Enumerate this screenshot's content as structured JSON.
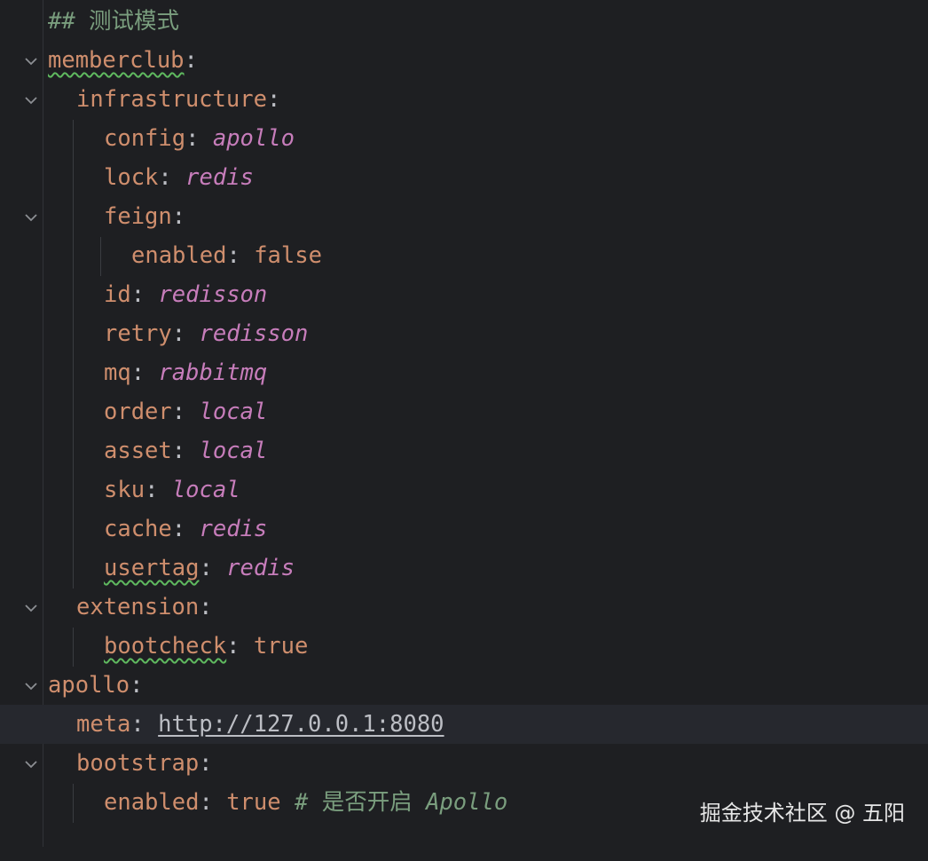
{
  "editor": {
    "language": "yaml",
    "colors": {
      "background": "#1e1f22",
      "key": "#cf8e6d",
      "string_value": "#c77dbb",
      "comment": "#7a9e7e",
      "plain": "#bcbec4",
      "spell_squiggle": "#5fb95f"
    },
    "lines": {
      "l1": {
        "comment": "## 测试模式"
      },
      "l2": {
        "key": "memberclub",
        "colon": ":"
      },
      "l3": {
        "key": "infrastructure",
        "colon": ":"
      },
      "l4": {
        "key": "config",
        "colon": ":",
        "value": "apollo"
      },
      "l5": {
        "key": "lock",
        "colon": ":",
        "value": "redis"
      },
      "l6": {
        "key": "feign",
        "colon": ":"
      },
      "l7": {
        "key": "enabled",
        "colon": ":",
        "value": "false"
      },
      "l8": {
        "key": "id",
        "colon": ":",
        "value": "redisson"
      },
      "l9": {
        "key": "retry",
        "colon": ":",
        "value": "redisson"
      },
      "l10": {
        "key": "mq",
        "colon": ":",
        "value": "rabbitmq"
      },
      "l11": {
        "key": "order",
        "colon": ":",
        "value": "local"
      },
      "l12": {
        "key": "asset",
        "colon": ":",
        "value": "local"
      },
      "l13": {
        "key": "sku",
        "colon": ":",
        "value": "local"
      },
      "l14": {
        "key": "cache",
        "colon": ":",
        "value": "redis"
      },
      "l15": {
        "key": "usertag",
        "colon": ":",
        "value": "redis"
      },
      "l16": {
        "key": "extension",
        "colon": ":"
      },
      "l17": {
        "key": "bootcheck",
        "colon": ":",
        "value": "true"
      },
      "l18": {
        "key": "apollo",
        "colon": ":"
      },
      "l19": {
        "key": "meta",
        "colon": ":",
        "value": "http://127.0.0.1:8080"
      },
      "l20": {
        "key": "bootstrap",
        "colon": ":"
      },
      "l21": {
        "key": "enabled",
        "colon": ":",
        "value": "true",
        "comment_hash": "#",
        "comment_cn": "是否开启",
        "comment_en": "Apollo"
      }
    },
    "fold_icon": "chevron-down-icon"
  },
  "watermark": "掘金技术社区 @ 五阳"
}
